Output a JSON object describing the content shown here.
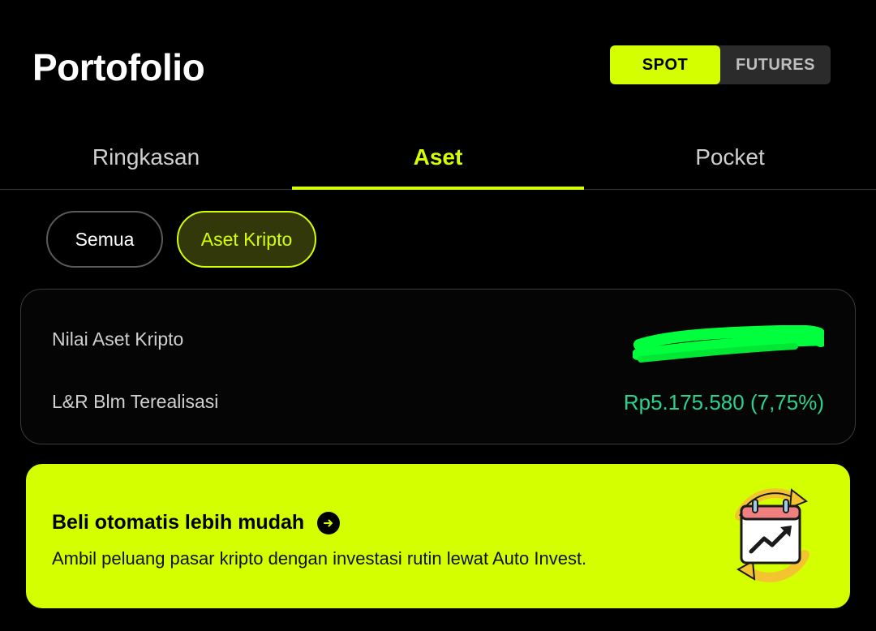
{
  "header": {
    "title": "Portofolio",
    "modes": [
      "SPOT",
      "FUTURES"
    ],
    "active_mode": "SPOT"
  },
  "tabs": [
    {
      "label": "Ringkasan",
      "active": false
    },
    {
      "label": "Aset",
      "active": true
    },
    {
      "label": "Pocket",
      "active": false
    }
  ],
  "filters": [
    {
      "label": "Semua",
      "active": false
    },
    {
      "label": "Aset Kripto",
      "active": true
    }
  ],
  "summary": {
    "asset_value_label": "Nilai Aset Kripto",
    "pnl_label": "L&R Blm Terealisasi",
    "pnl_value": "Rp5.175.580 (7,75%)"
  },
  "promo": {
    "title": "Beli otomatis lebih mudah",
    "description": "Ambil peluang pasar kripto dengan investasi rutin lewat Auto Invest."
  },
  "colors": {
    "accent": "#d4ff00",
    "background": "#000000",
    "positive": "#2ad28e",
    "redaction": "#00ff3c"
  },
  "icons": [
    "arrow-right-circle-icon",
    "calendar-chart-icon"
  ]
}
